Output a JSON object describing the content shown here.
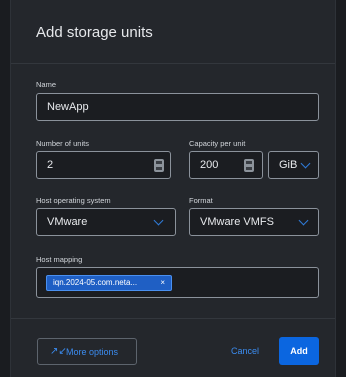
{
  "dialog": {
    "title": "Add storage units"
  },
  "form": {
    "name": {
      "label": "Name",
      "value": "NewApp"
    },
    "units": {
      "label": "Number of units",
      "value": "2"
    },
    "capacity": {
      "label": "Capacity per unit",
      "value": "200",
      "unit": "GiB"
    },
    "host_os": {
      "label": "Host operating system",
      "value": "VMware"
    },
    "format": {
      "label": "Format",
      "value": "VMware VMFS"
    },
    "host_mapping": {
      "label": "Host mapping",
      "chip": "iqn.2024-05.com.neta...",
      "chip_close": "×"
    }
  },
  "footer": {
    "more_options_icon": "↗↙",
    "more_options": "More options",
    "cancel": "Cancel",
    "add": "Add"
  },
  "colors": {
    "accent": "#0b66e0",
    "link": "#3b8cf0",
    "surface": "#24272c"
  },
  "icons": {
    "stepper": "stepper-icon",
    "chevron": "chevron-down-icon",
    "expand": "expand-icon"
  }
}
